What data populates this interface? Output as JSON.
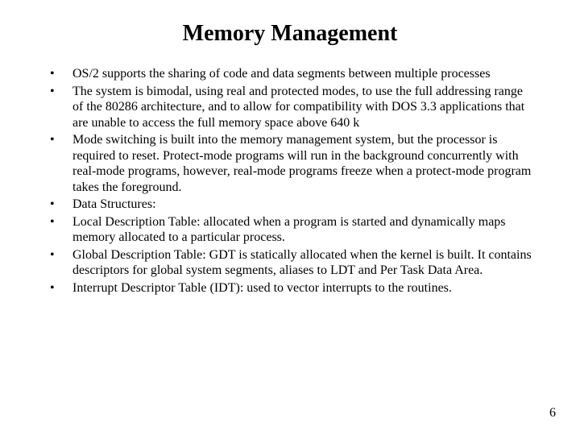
{
  "title": "Memory Management",
  "bullets": [
    "OS/2 supports the sharing of code and data segments between multiple processes",
    "The system is bimodal, using real and protected modes, to use the full addressing range of the 80286 architecture, and to allow for compatibility with DOS 3.3 applications that are unable to access the full memory space above 640 k",
    "Mode switching is built into the memory management system, but the processor is required to reset. Protect-mode programs will run in the background concurrently with real-mode programs, however, real-mode programs freeze when a protect-mode program takes the foreground.",
    "Data Structures:",
    "Local Description Table: allocated when a program is started and dynamically maps  memory allocated to a particular process.",
    "Global Description Table: GDT is statically allocated when the kernel is built. It contains descriptors for global system segments, aliases to LDT and Per Task Data Area.",
    "Interrupt Descriptor Table (IDT): used to vector interrupts to the routines."
  ],
  "page_number": "6"
}
